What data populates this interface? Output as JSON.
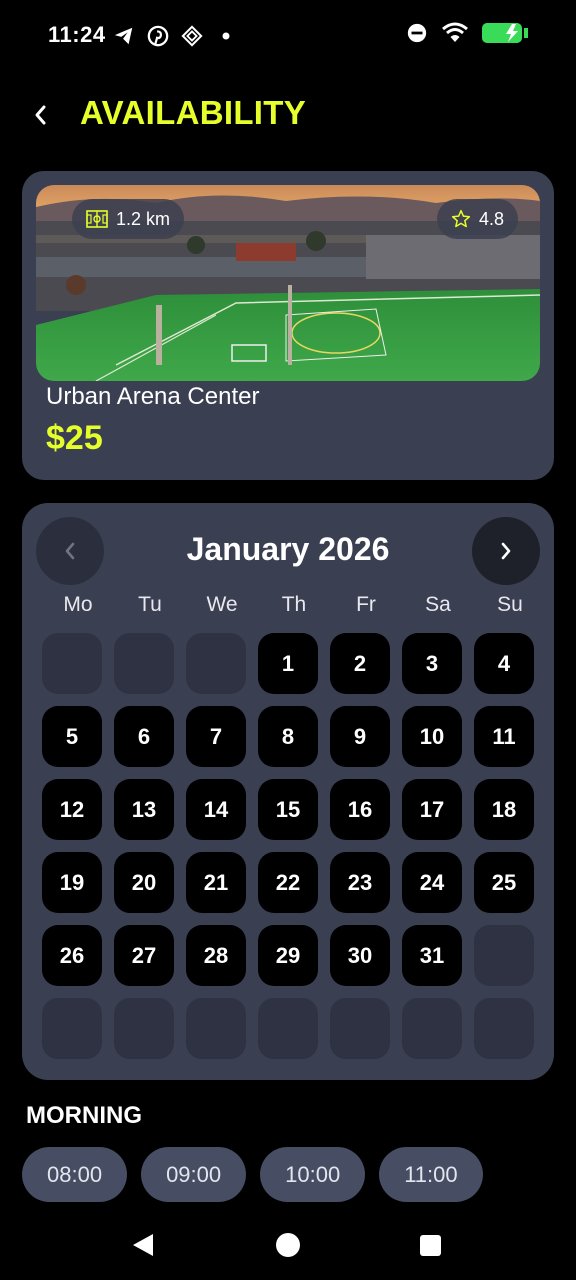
{
  "status_bar": {
    "time": "11:24",
    "icons": [
      "telegram-icon",
      "pinterest-icon",
      "app-icon",
      "dot-icon",
      "dnd-icon",
      "wifi-icon",
      "battery-charging-icon"
    ]
  },
  "header": {
    "title": "AVAILABILITY",
    "back_icon": "chevron-left-icon"
  },
  "venue": {
    "distance": "1.2 km",
    "rating": "4.8",
    "name": "Urban Arena Center",
    "price": "$25"
  },
  "calendar": {
    "month_label": "January 2026",
    "weekdays": [
      "Mo",
      "Tu",
      "We",
      "Th",
      "Fr",
      "Sa",
      "Su"
    ],
    "days": [
      "",
      "",
      "",
      "1",
      "2",
      "3",
      "4",
      "5",
      "6",
      "7",
      "8",
      "9",
      "10",
      "11",
      "12",
      "13",
      "14",
      "15",
      "16",
      "17",
      "18",
      "19",
      "20",
      "21",
      "22",
      "23",
      "24",
      "25",
      "26",
      "27",
      "28",
      "29",
      "30",
      "31",
      "",
      "",
      "",
      "",
      "",
      "",
      "",
      ""
    ]
  },
  "morning": {
    "title": "MORNING",
    "slots": [
      "08:00",
      "09:00",
      "10:00",
      "11:00"
    ]
  },
  "colors": {
    "accent": "#E6FF2B",
    "card": "#3A3F52",
    "day_active": "#000000",
    "day_empty": "#2E3242",
    "slot": "#474D63"
  }
}
